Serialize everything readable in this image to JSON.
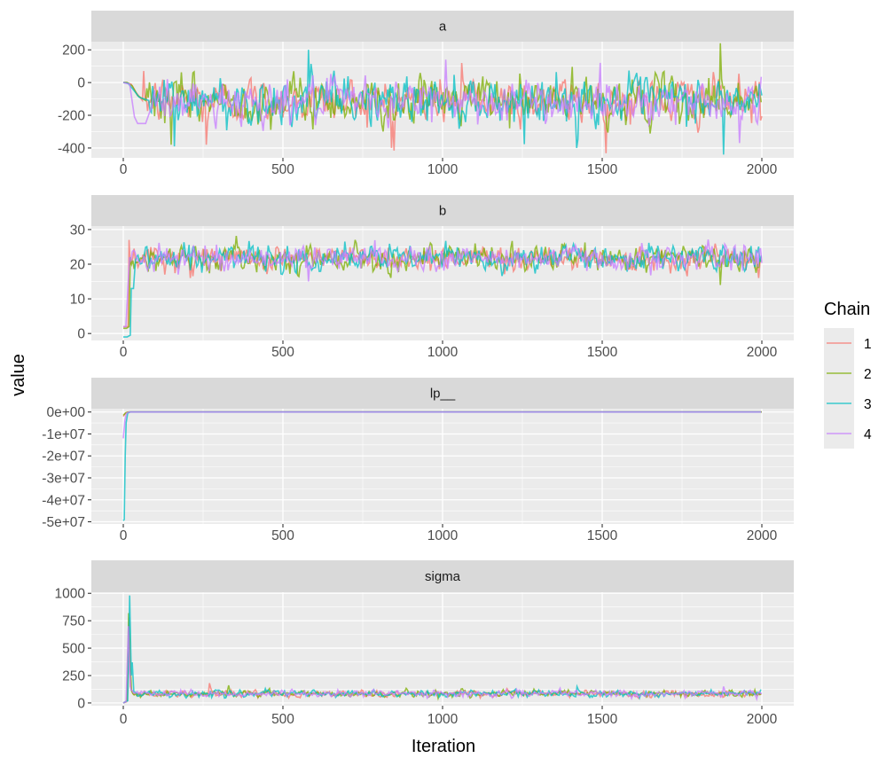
{
  "chart_data": {
    "type": "line",
    "xlabel": "Iteration",
    "ylabel": "value",
    "xlim": [
      0,
      2000
    ],
    "x_ticks": [
      0,
      500,
      1000,
      1500,
      2000
    ],
    "x_tick_labels": [
      "0",
      "500",
      "1000",
      "1500",
      "2000"
    ],
    "legend": {
      "title": "Chain",
      "position": "right",
      "entries": [
        {
          "label": "1",
          "color": "#F8766D"
        },
        {
          "label": "2",
          "color": "#7CAE00"
        },
        {
          "label": "3",
          "color": "#00BFC4"
        },
        {
          "label": "4",
          "color": "#C77CFF"
        }
      ]
    },
    "grid": true,
    "series_opacity": 0.75,
    "panels": [
      {
        "name": "a",
        "ylim": [
          -460,
          250
        ],
        "y_ticks": [
          200,
          0,
          -200,
          -400
        ],
        "y_tick_labels": [
          "200",
          "0",
          "-200",
          "-400"
        ],
        "chains": [
          {
            "chain": "1",
            "warmup": [
              [
                0,
                0
              ],
              [
                10,
                0
              ],
              [
                25,
                -10
              ],
              [
                40,
                -60
              ],
              [
                60,
                -110
              ]
            ],
            "center": -110,
            "spread": 65,
            "extremes": [
              [
                170,
                130
              ],
              [
                260,
                -380
              ],
              [
                410,
                -390
              ],
              [
                840,
                -400
              ],
              [
                1060,
                120
              ],
              [
                1130,
                150
              ],
              [
                1990,
                120
              ]
            ]
          },
          {
            "chain": "2",
            "warmup": [
              [
                0,
                0
              ],
              [
                12,
                0
              ],
              [
                28,
                -20
              ],
              [
                45,
                -80
              ],
              [
                70,
                -110
              ]
            ],
            "center": -110,
            "spread": 65,
            "extremes": [
              [
                150,
                -380
              ],
              [
                520,
                130
              ],
              [
                1300,
                -410
              ],
              [
                1560,
                -320
              ],
              [
                1870,
                240
              ],
              [
                1880,
                -230
              ]
            ]
          },
          {
            "chain": "3",
            "warmup": [
              [
                0,
                0
              ],
              [
                15,
                -5
              ],
              [
                30,
                -40
              ],
              [
                50,
                -90
              ],
              [
                80,
                -110
              ]
            ],
            "center": -110,
            "spread": 65,
            "extremes": [
              [
                160,
                -390
              ],
              [
                330,
                150
              ],
              [
                580,
                200
              ],
              [
                1420,
                -400
              ],
              [
                1750,
                -300
              ],
              [
                1880,
                -440
              ]
            ]
          },
          {
            "chain": "4",
            "warmup": [
              [
                0,
                0
              ],
              [
                20,
                -10
              ],
              [
                35,
                -210
              ],
              [
                45,
                -250
              ],
              [
                70,
                -250
              ],
              [
                90,
                -140
              ]
            ],
            "center": -115,
            "spread": 60,
            "extremes": [
              [
                580,
                200
              ],
              [
                1010,
                140
              ],
              [
                1840,
                -350
              ],
              [
                1930,
                -370
              ]
            ]
          }
        ]
      },
      {
        "name": "b",
        "ylim": [
          -2,
          31
        ],
        "y_ticks": [
          30,
          20,
          10,
          0
        ],
        "y_tick_labels": [
          "30",
          "20",
          "10",
          "0"
        ],
        "chains": [
          {
            "chain": "1",
            "warmup": [
              [
                0,
                2
              ],
              [
                10,
                2
              ],
              [
                15,
                2
              ],
              [
                18,
                27
              ],
              [
                22,
                20
              ]
            ],
            "center": 21.8,
            "spread": 1.7,
            "extremes": [
              [
                130,
                17
              ],
              [
                300,
                27.5
              ],
              [
                1990,
                16
              ]
            ]
          },
          {
            "chain": "2",
            "warmup": [
              [
                0,
                1.5
              ],
              [
                10,
                1.5
              ],
              [
                18,
                2
              ],
              [
                22,
                22
              ],
              [
                26,
                20
              ]
            ],
            "center": 21.8,
            "spread": 1.7,
            "extremes": [
              [
                420,
                27
              ],
              [
                1870,
                14
              ]
            ]
          },
          {
            "chain": "3",
            "warmup": [
              [
                0,
                -1
              ],
              [
                12,
                -1
              ],
              [
                22,
                -0.5
              ],
              [
                25,
                13
              ],
              [
                32,
                13
              ],
              [
                38,
                21
              ]
            ],
            "center": 21.8,
            "spread": 1.7,
            "extremes": [
              [
                1880,
                29
              ],
              [
                160,
                28
              ]
            ]
          },
          {
            "chain": "4",
            "warmup": [
              [
                0,
                2
              ],
              [
                8,
                2
              ],
              [
                15,
                14
              ],
              [
                20,
                22
              ]
            ],
            "center": 21.8,
            "spread": 1.7,
            "extremes": [
              [
                580,
                15
              ],
              [
                1910,
                28.5
              ]
            ]
          }
        ]
      },
      {
        "name": "lp__",
        "ylim": [
          -51000000,
          1500000
        ],
        "y_ticks": [
          0,
          -10000000,
          -20000000,
          -30000000,
          -40000000,
          -50000000
        ],
        "y_tick_labels": [
          "0e+00",
          "-1e+07",
          "-2e+07",
          "-3e+07",
          "-4e+07",
          "-5e+07"
        ],
        "chains": [
          {
            "chain": "1",
            "warmup": [
              [
                0,
                -2000000
              ],
              [
                5,
                -800000
              ],
              [
                12,
                -200000
              ],
              [
                20,
                0
              ]
            ],
            "center": 0,
            "spread": 0,
            "extremes": []
          },
          {
            "chain": "2",
            "warmup": [
              [
                0,
                -1500000
              ],
              [
                8,
                -300000
              ],
              [
                16,
                0
              ]
            ],
            "center": 0,
            "spread": 0,
            "extremes": []
          },
          {
            "chain": "3",
            "warmup": [
              [
                0,
                -49500000
              ],
              [
                3,
                -49000000
              ],
              [
                6,
                -20000000
              ],
              [
                9,
                -5000000
              ],
              [
                14,
                -500000
              ],
              [
                22,
                0
              ]
            ],
            "center": 0,
            "spread": 0,
            "extremes": []
          },
          {
            "chain": "4",
            "warmup": [
              [
                0,
                -12000000
              ],
              [
                5,
                -4000000
              ],
              [
                10,
                -600000
              ],
              [
                18,
                0
              ]
            ],
            "center": 0,
            "spread": 0,
            "extremes": []
          }
        ]
      },
      {
        "name": "sigma",
        "ylim": [
          -25,
          1010
        ],
        "y_ticks": [
          1000,
          750,
          500,
          250,
          0
        ],
        "y_tick_labels": [
          "1000",
          "750",
          "500",
          "250",
          "0"
        ],
        "chains": [
          {
            "chain": "1",
            "warmup": [
              [
                0,
                0
              ],
              [
                10,
                10
              ],
              [
                14,
                120
              ],
              [
                18,
                780
              ],
              [
                22,
                150
              ],
              [
                30,
                90
              ]
            ],
            "center": 85,
            "spread": 14,
            "extremes": [
              [
                270,
                180
              ],
              [
                1780,
                160
              ]
            ]
          },
          {
            "chain": "2",
            "warmup": [
              [
                0,
                0
              ],
              [
                12,
                20
              ],
              [
                17,
                820
              ],
              [
                21,
                400
              ],
              [
                26,
                110
              ]
            ],
            "center": 85,
            "spread": 14,
            "extremes": [
              [
                330,
                160
              ]
            ]
          },
          {
            "chain": "3",
            "warmup": [
              [
                0,
                0
              ],
              [
                14,
                20
              ],
              [
                20,
                980
              ],
              [
                25,
                250
              ],
              [
                28,
                370
              ],
              [
                33,
                100
              ]
            ],
            "center": 85,
            "spread": 14,
            "extremes": [
              [
                1420,
                150
              ]
            ]
          },
          {
            "chain": "4",
            "warmup": [
              [
                0,
                0
              ],
              [
                9,
                15
              ],
              [
                16,
                700
              ],
              [
                20,
                300
              ],
              [
                24,
                120
              ]
            ],
            "center": 85,
            "spread": 14,
            "extremes": [
              [
                290,
                190
              ],
              [
                1880,
                150
              ]
            ]
          }
        ]
      }
    ]
  }
}
